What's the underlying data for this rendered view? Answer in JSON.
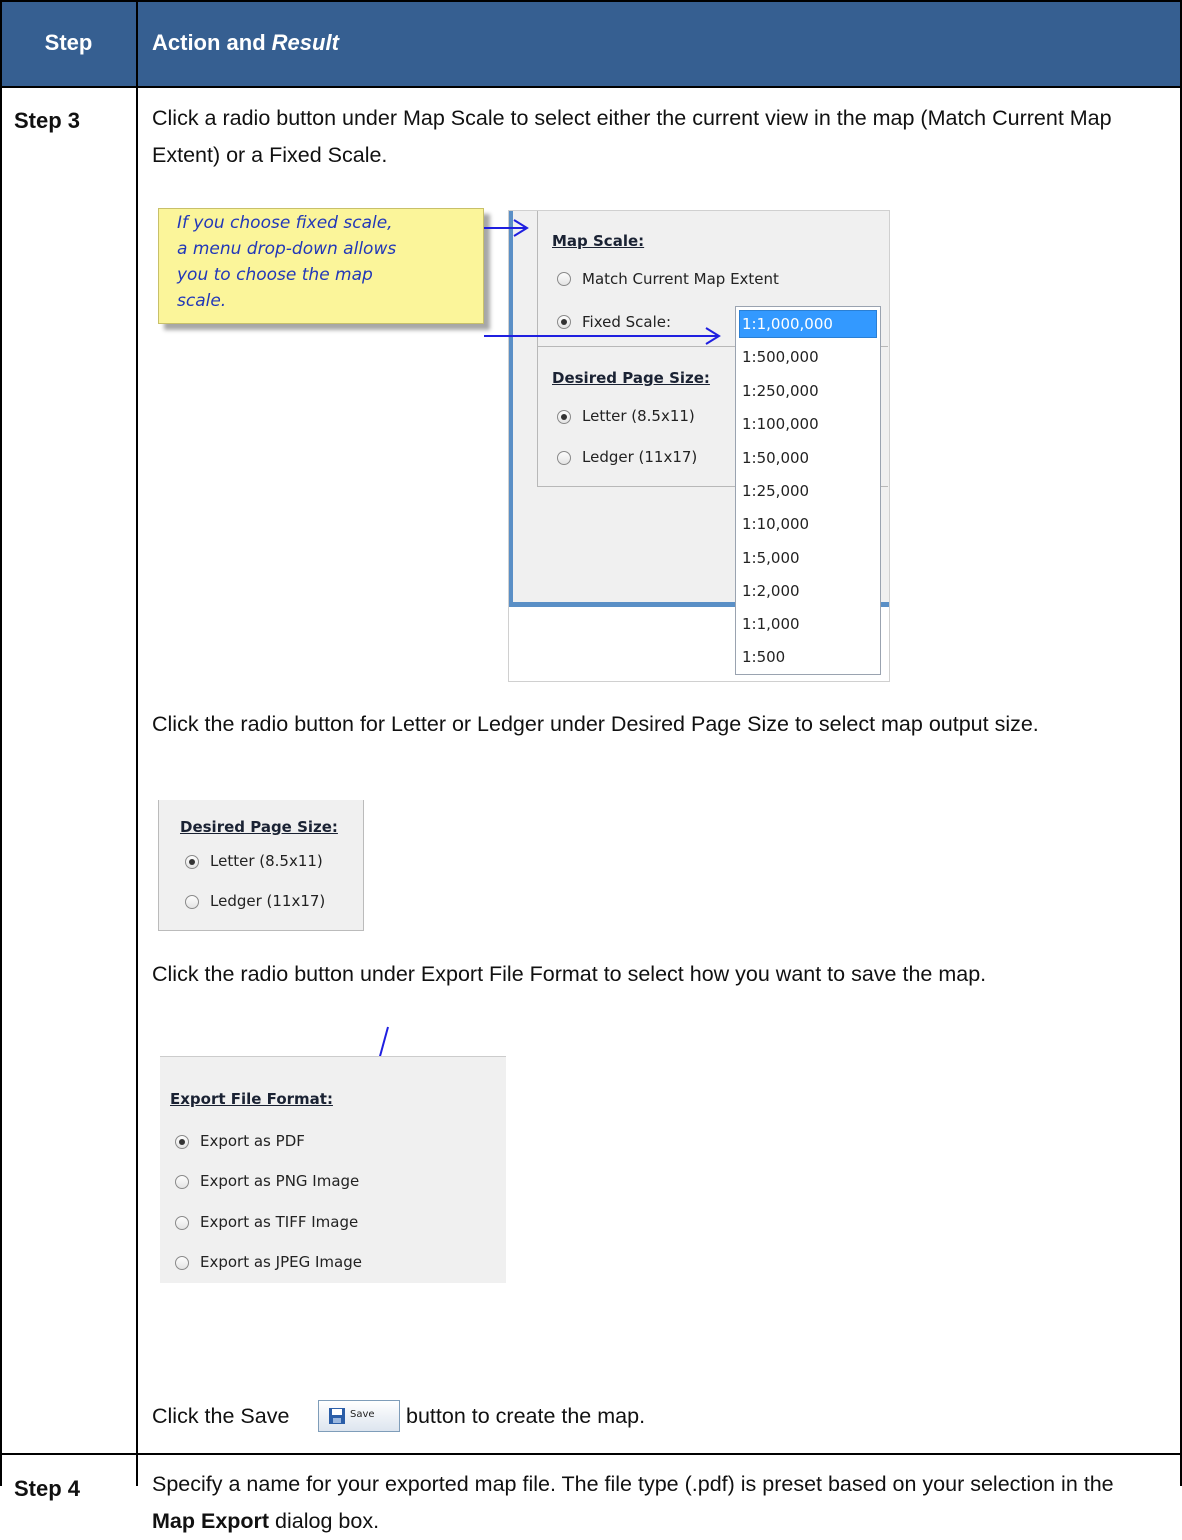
{
  "header": {
    "step": "Step",
    "action": "Action and ",
    "result": "Result"
  },
  "rows": [
    {
      "step": "Step 3",
      "p1": "Click a radio button under Map Scale to select either the current view in the map (Match Current Map Extent) or a Fixed Scale.",
      "callout_lines": [
        "If you choose fixed scale,",
        "a menu drop-down allows",
        "you to choose the map",
        "scale."
      ],
      "map_scale": {
        "heading": "Map Scale:",
        "opt1": "Match Current Map Extent",
        "opt2": "Fixed Scale:",
        "options": [
          "1:1,000,000",
          "1:500,000",
          "1:250,000",
          "1:100,000",
          "1:50,000",
          "1:25,000",
          "1:10,000",
          "1:5,000",
          "1:2,000",
          "1:1,000",
          "1:500"
        ]
      },
      "page_size": {
        "heading": "Desired Page Size:",
        "opt1": "Letter (8.5x11)",
        "opt2": "Ledger (11x17)"
      },
      "p2": "Click the radio button for Letter or Ledger under Desired Page Size to select map output size.",
      "p3": "Click the radio button under Export File Format to select how you want to save the map.",
      "export": {
        "heading": "Export File Format:",
        "options": [
          "Export as PDF",
          "Export as PNG Image",
          "Export as TIFF Image",
          "Export as JPEG Image"
        ]
      },
      "p4_before": "Click the Save",
      "save_label": "Save",
      "p4_after": "button to create the map."
    },
    {
      "step": "Step 4",
      "p1a": "Specify a name for your exported map file. The file type (.pdf) is preset based on your selection in the ",
      "p1b": "Map Export",
      "p1c": " dialog box."
    }
  ],
  "colors": {
    "header_bg": "#365f91",
    "callout_text": "#2238b8",
    "arrow": "#1f1fe0",
    "selected_item": "#3399ff"
  },
  "icons": [
    "floppy-disk-icon",
    "radio-button",
    "arrow"
  ]
}
